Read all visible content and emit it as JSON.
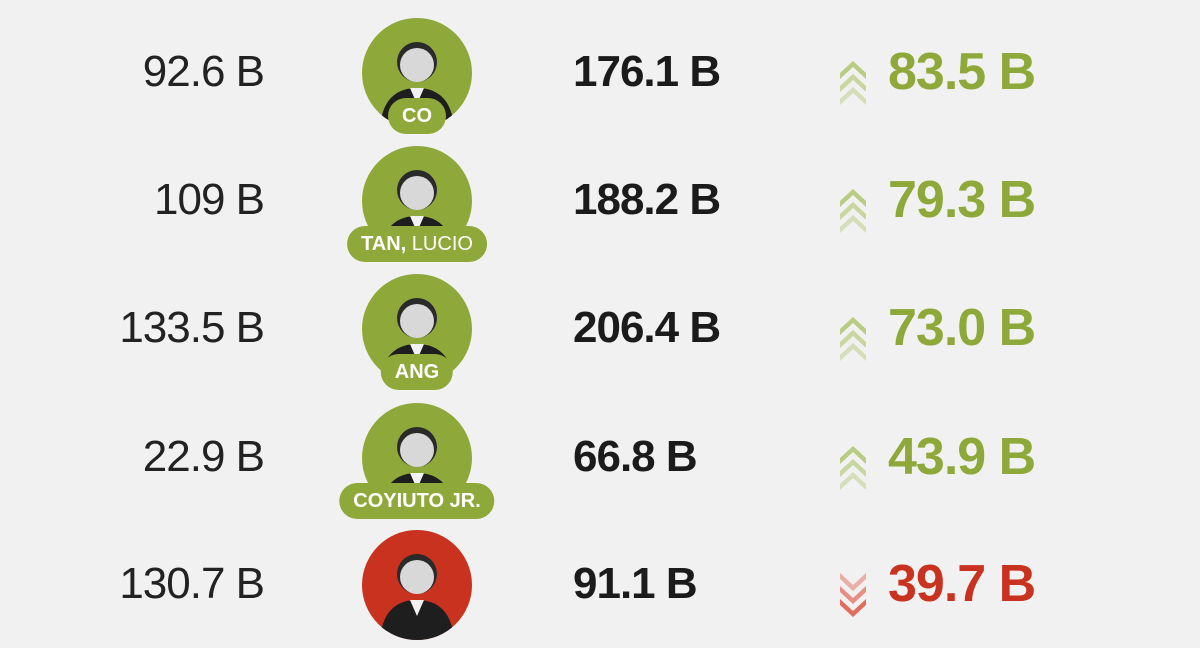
{
  "colors": {
    "increase": "#8fa83a",
    "decrease": "#c8321f",
    "arrow_up": "#b9cc84",
    "arrow_down": "#e26d5c"
  },
  "rows": [
    {
      "name": "CO",
      "given": "",
      "before": "92.6 B",
      "after": "176.1 B",
      "change": "83.5 B",
      "direction": "up"
    },
    {
      "name": "TAN,",
      "given": " LUCIO",
      "before": "109 B",
      "after": "188.2 B",
      "change": "79.3 B",
      "direction": "up"
    },
    {
      "name": "ANG",
      "given": "",
      "before": "133.5 B",
      "after": "206.4 B",
      "change": "73.0 B",
      "direction": "up"
    },
    {
      "name": "COYIUTO JR.",
      "given": "",
      "before": "22.9 B",
      "after": "66.8 B",
      "change": "43.9 B",
      "direction": "up"
    },
    {
      "name": "",
      "given": "",
      "before": "130.7 B",
      "after": "91.1 B",
      "change": "39.7 B",
      "direction": "down"
    }
  ],
  "chart_data": {
    "type": "table",
    "columns": [],
    "rows": [
      {
        "name": "CO",
        "before": 92.6,
        "after": 176.1,
        "change": 83.5,
        "direction": "up",
        "unit": "B"
      },
      {
        "name": "TAN, LUCIO",
        "before": 109,
        "after": 188.2,
        "change": 79.3,
        "direction": "up",
        "unit": "B"
      },
      {
        "name": "ANG",
        "before": 133.5,
        "after": 206.4,
        "change": 73.0,
        "direction": "up",
        "unit": "B"
      },
      {
        "name": "COYIUTO JR.",
        "before": 22.9,
        "after": 66.8,
        "change": 43.9,
        "direction": "up",
        "unit": "B"
      },
      {
        "name": "",
        "before": 130.7,
        "after": 91.1,
        "change": 39.7,
        "direction": "down",
        "unit": "B"
      }
    ]
  }
}
